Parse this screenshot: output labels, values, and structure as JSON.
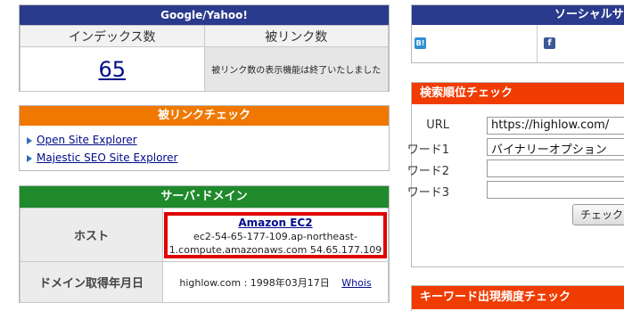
{
  "google_yahoo": {
    "title": "Google/Yahoo!",
    "index_header": "インデックス数",
    "backlink_header": "被リンク数",
    "index_count": "65",
    "backlink_note": "被リンク数の表示機能は終了いたしました"
  },
  "backlink_check": {
    "title": "被リンクチェック",
    "links": [
      "Open Site Explorer",
      "Majestic SEO Site Explorer"
    ]
  },
  "server_domain": {
    "title": "サーバ･ドメイン",
    "host_label": "ホスト",
    "host_name": "Amazon EC2",
    "host_line1": "ec2-54-65-177-109.ap-northeast-",
    "host_line2": "1.compute.amazonaws.com 54.65.177.109",
    "domain_date_label": "ドメイン取得年月日",
    "domain_date_value": "highlow.com : 1998年03月17日",
    "whois_link": "Whois"
  },
  "social": {
    "title": "ソーシャルサ",
    "icons": [
      "hatena-bookmark-icon",
      "facebook-icon"
    ],
    "hatena_text": "B!",
    "facebook_text": "f"
  },
  "rank_check": {
    "title": "検索順位チェック",
    "url_label": "URL",
    "url_value": "https://highlow.com/",
    "word1_label": "ワード1",
    "word1_value": "バイナリーオプション",
    "word2_label": "ワード2",
    "word2_value": "",
    "word3_label": "ワード3",
    "word3_value": "",
    "check_button": "チェック"
  },
  "keyword_freq": {
    "title": "キーワード出現頻度チェック"
  },
  "colors": {
    "navy_header": "#2a3a8c",
    "orange_header": "#f07800",
    "green_header": "#1f8a2c",
    "red_header": "#f03c00",
    "highlight_border": "#e00000"
  }
}
